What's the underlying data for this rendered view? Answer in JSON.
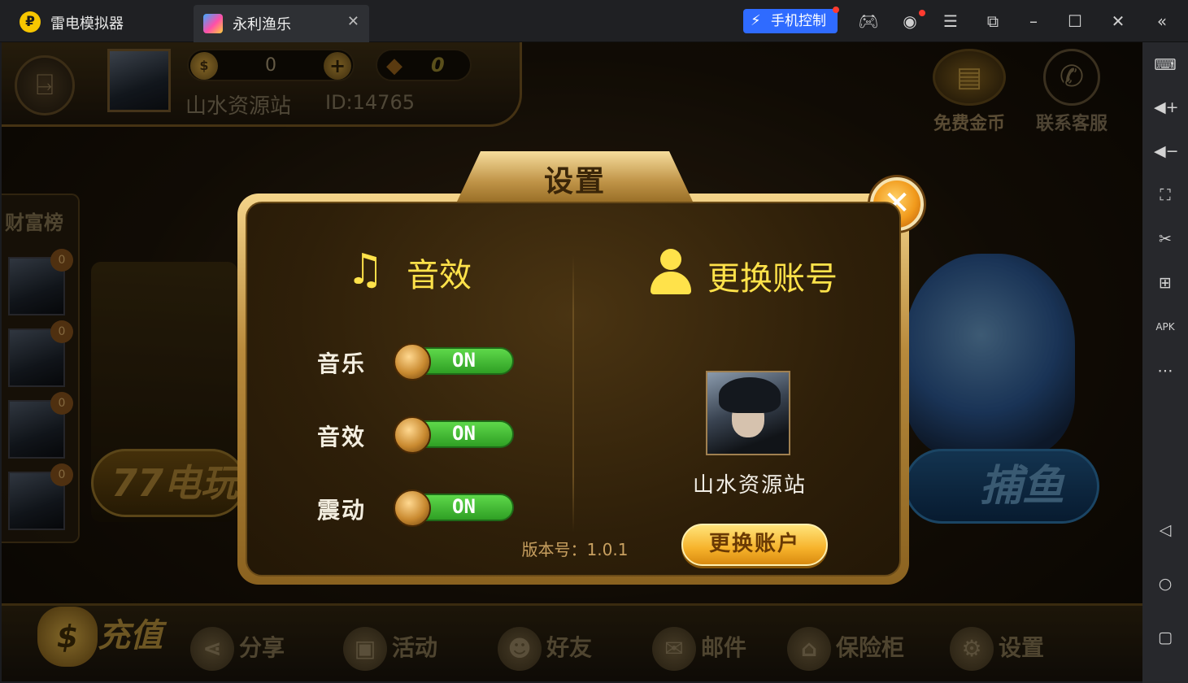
{
  "emulator": {
    "app_name": "雷电模拟器",
    "tab_title": "永利渔乐",
    "phone_control": "手机控制",
    "toolbar_icons": [
      "gamepad-icon",
      "account-icon",
      "menu-icon",
      "popout-icon",
      "minimize-icon",
      "maximize-icon",
      "close-icon",
      "collapse-icon"
    ],
    "sidebar_icons": [
      "keyboard-icon",
      "volume-up-icon",
      "volume-down-icon",
      "screenshot-icon",
      "scissors-icon",
      "add-window-icon",
      "apk-install-icon",
      "more-icon",
      "back-icon",
      "home-icon",
      "recents-icon"
    ]
  },
  "game": {
    "coins": "0",
    "gems": "0",
    "nickname": "山水资源站",
    "user_id": "ID:14765",
    "free_coins": "免费金币",
    "contact_service": "联系客服",
    "rank_title": "财富榜",
    "rank_badge": "0",
    "slot_label": "77电玩",
    "fish_label": "捕鱼",
    "bottom_nav": {
      "recharge": "充值",
      "share": "分享",
      "activity": "活动",
      "friends": "好友",
      "mail": "邮件",
      "safe": "保险柜",
      "settings": "设置"
    }
  },
  "dialog": {
    "title": "设置",
    "sound_section": "音效",
    "account_section": "更换账号",
    "options": [
      {
        "label": "音乐",
        "state": "ON"
      },
      {
        "label": "音效",
        "state": "ON"
      },
      {
        "label": "震动",
        "state": "ON"
      }
    ],
    "account_name": "山水资源站",
    "switch_button": "更换账户",
    "version": "版本号：1.0.1"
  },
  "colors": {
    "accent_yellow": "#ffe24a",
    "toggle_on": "#3fb52e",
    "phone_control_blue": "#2f6bff"
  }
}
